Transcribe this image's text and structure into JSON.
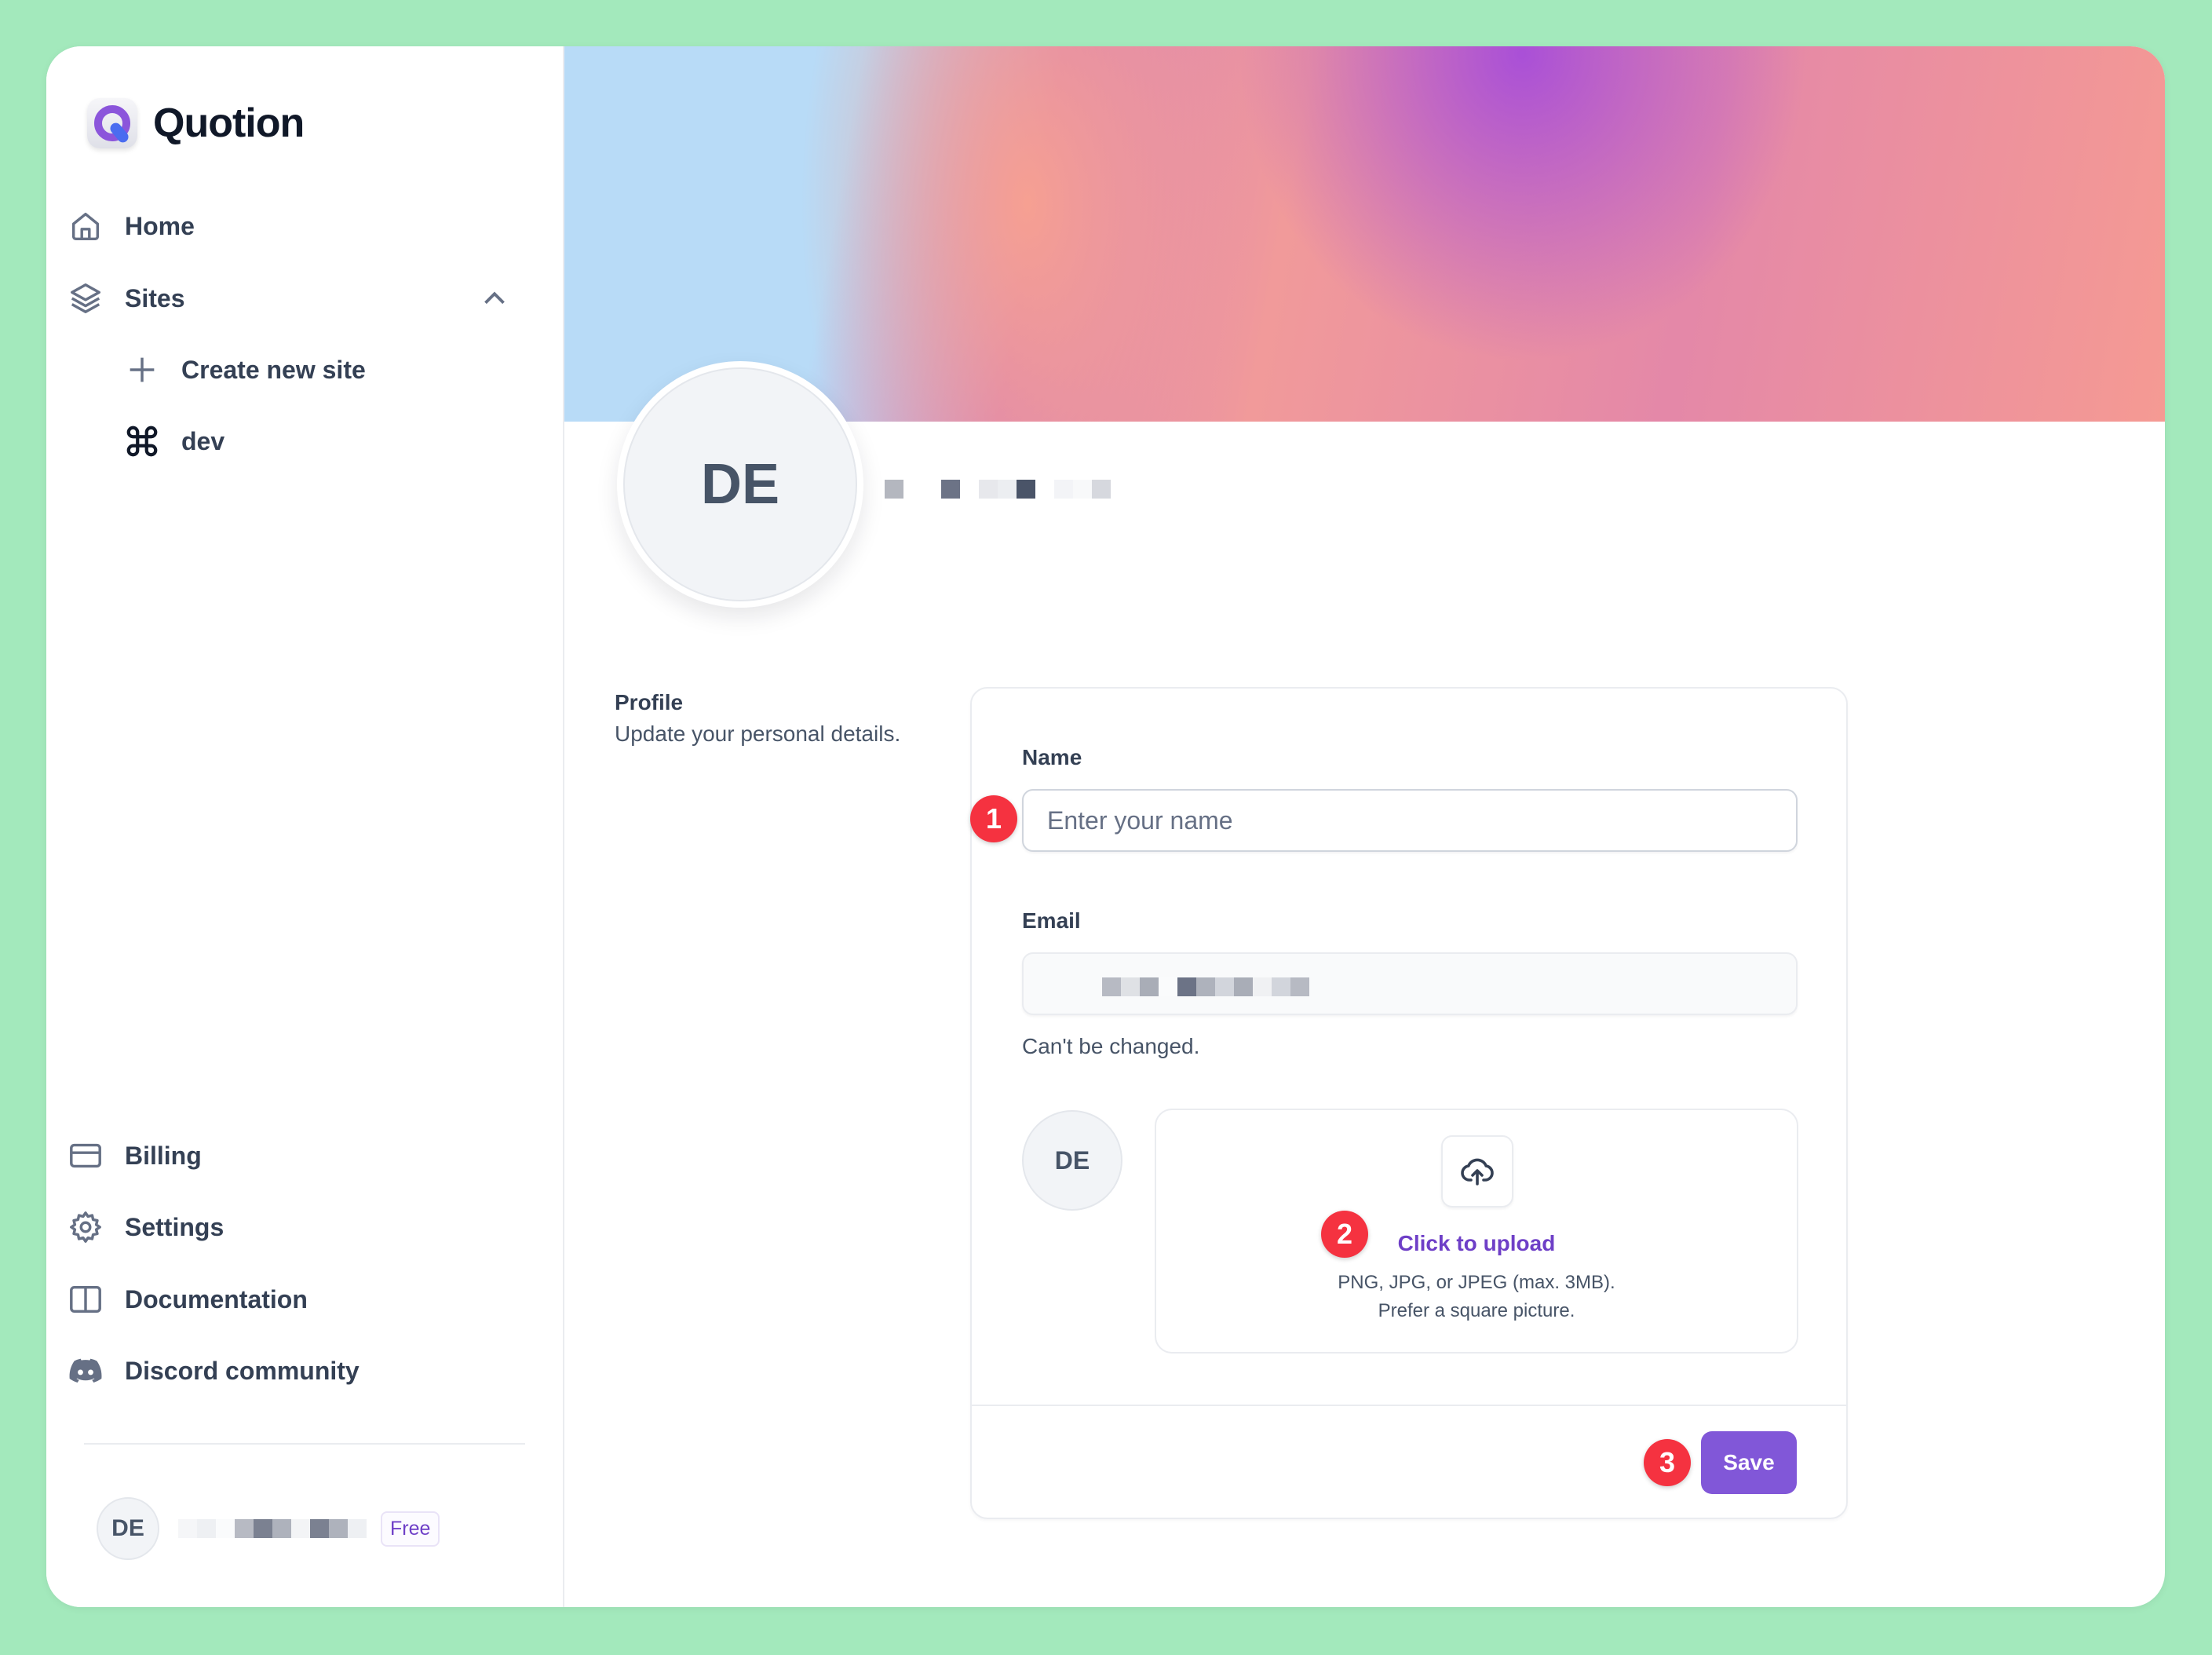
{
  "app": {
    "name": "Quotion",
    "logo_icon": "quotion-q-logo"
  },
  "sidebar": {
    "top_items": [
      {
        "label": "Home",
        "icon": "home-icon"
      },
      {
        "label": "Sites",
        "icon": "layers-icon",
        "expanded": true
      }
    ],
    "sites_children": [
      {
        "label": "Create new site",
        "icon": "plus-icon"
      },
      {
        "label": "dev",
        "icon": "command-icon"
      }
    ],
    "bottom_items": [
      {
        "label": "Billing",
        "icon": "credit-card-icon"
      },
      {
        "label": "Settings",
        "icon": "gear-icon"
      },
      {
        "label": "Documentation",
        "icon": "book-icon"
      },
      {
        "label": "Discord community",
        "icon": "discord-icon"
      }
    ],
    "user": {
      "initials": "DE",
      "name_redacted": true,
      "plan_badge": "Free"
    }
  },
  "profile_header": {
    "initials": "DE",
    "name_redacted": true
  },
  "profile_section": {
    "title": "Profile",
    "description": "Update your personal details."
  },
  "form": {
    "name": {
      "label": "Name",
      "value": "",
      "placeholder": "Enter your name"
    },
    "email": {
      "label": "Email",
      "value_redacted": true,
      "hint": "Can't be changed."
    },
    "avatar": {
      "initials": "DE",
      "upload_icon": "cloud-upload-icon",
      "upload_link": "Click to upload",
      "upload_hint_formats": "PNG, JPG, or JPEG (max. 3MB).",
      "upload_hint_shape": "Prefer a square picture."
    },
    "save_label": "Save"
  },
  "annotations": [
    {
      "number": "1",
      "target": "name-input"
    },
    {
      "number": "2",
      "target": "upload-area"
    },
    {
      "number": "3",
      "target": "save-button"
    }
  ],
  "colors": {
    "accent": "#8157d8",
    "link": "#6e3fc7",
    "marker": "#f53240",
    "background": "#a3e9bc"
  }
}
